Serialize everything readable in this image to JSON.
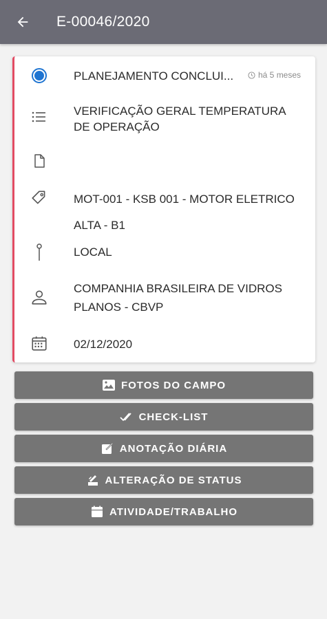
{
  "appbar": {
    "title": "E-00046/2020",
    "back_icon": "arrow-left-icon"
  },
  "card": {
    "accent_color": "#e24b63",
    "status": {
      "label": "PLANEJAMENTO CONCLUI...",
      "time": "há 5 meses",
      "icon": "radio-filled-icon",
      "color": "#1e74d1"
    },
    "description": "VERIFICAÇÃO GERAL TEMPERATURA DE OPERAÇÃO",
    "document": "",
    "equipment": {
      "name": "MOT-001 - KSB 001 - MOTOR ELETRICO",
      "priority": "ALTA - B1"
    },
    "location": "LOCAL",
    "company": "COMPANHIA BRASILEIRA DE VIDROS PLANOS - CBVP",
    "date": "02/12/2020"
  },
  "actions": [
    {
      "label": "FOTOS DO CAMPO",
      "icon": "image-icon"
    },
    {
      "label": "CHECK-LIST",
      "icon": "double-check-icon"
    },
    {
      "label": "ANOTAÇÃO DIÁRIA",
      "icon": "note-edit-icon"
    },
    {
      "label": "ALTERAÇÃO DE STATUS",
      "icon": "status-stack-icon"
    },
    {
      "label": "ATIVIDADE/TRABALHO",
      "icon": "calendar-icon"
    }
  ]
}
